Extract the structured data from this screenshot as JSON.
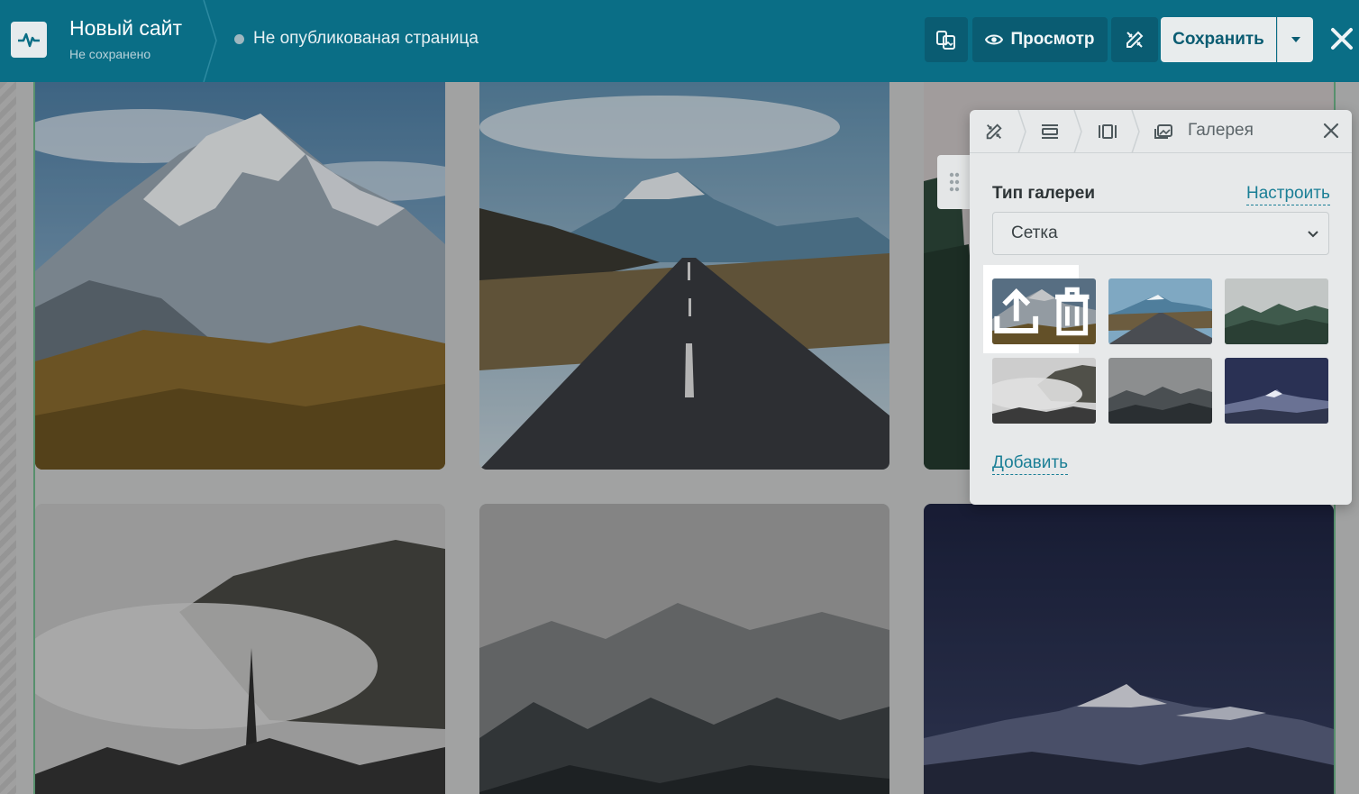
{
  "header": {
    "site_title": "Новый сайт",
    "site_subtitle": "Не сохранено",
    "status_text": "Не опубликованая страница",
    "preview_label": "Просмотр",
    "save_label": "Сохранить"
  },
  "panel": {
    "title": "Галерея",
    "gallery_type_label": "Тип галереи",
    "setup_link": "Настроить",
    "gallery_type_value": "Сетка",
    "add_link": "Добавить",
    "thumbnails": [
      "snowy-mountain",
      "road-mountain",
      "foggy-forest",
      "misty-trees",
      "fog-forest-dark",
      "night-mountain"
    ]
  },
  "canvas": {
    "images": [
      "snowy-mountain",
      "road-mountain",
      "forest-edge",
      "misty-trees",
      "fog-forest",
      "night-mountain"
    ]
  },
  "colors": {
    "header_bg": "#0a6e86",
    "button_dark": "#0a5c72",
    "save_bg": "#e8eced",
    "link": "#1b7f96",
    "accent_green": "#58b37a"
  }
}
